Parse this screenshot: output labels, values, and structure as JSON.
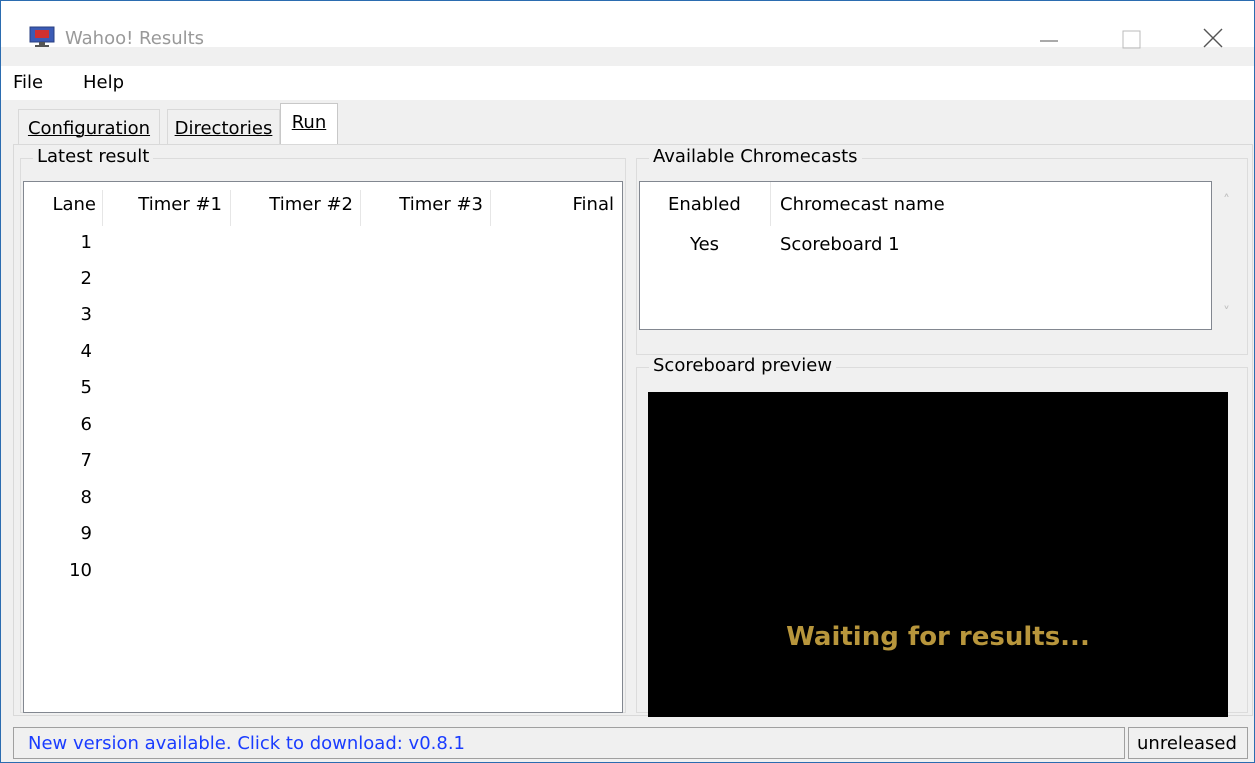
{
  "window": {
    "title": "Wahoo! Results"
  },
  "menu": {
    "file": "File",
    "help": "Help"
  },
  "tabs": [
    {
      "label": "Configuration",
      "active": false
    },
    {
      "label": "Directories",
      "active": false
    },
    {
      "label": "Run",
      "active": true
    }
  ],
  "latest_result": {
    "title": "Latest result",
    "columns": [
      "Lane",
      "Timer #1",
      "Timer #2",
      "Timer #3",
      "Final"
    ],
    "lanes": [
      "1",
      "2",
      "3",
      "4",
      "5",
      "6",
      "7",
      "8",
      "9",
      "10"
    ]
  },
  "chromecasts": {
    "title": "Available Chromecasts",
    "columns": [
      "Enabled",
      "Chromecast name"
    ],
    "rows": [
      {
        "enabled": "Yes",
        "name": "Scoreboard 1"
      }
    ]
  },
  "preview": {
    "title": "Scoreboard preview",
    "message": "Waiting for results...",
    "message_color": "#b8963c"
  },
  "status": {
    "update_message": "New version available. Click to download: v0.8.1",
    "version": "unreleased",
    "link_color": "#1a3cff"
  }
}
